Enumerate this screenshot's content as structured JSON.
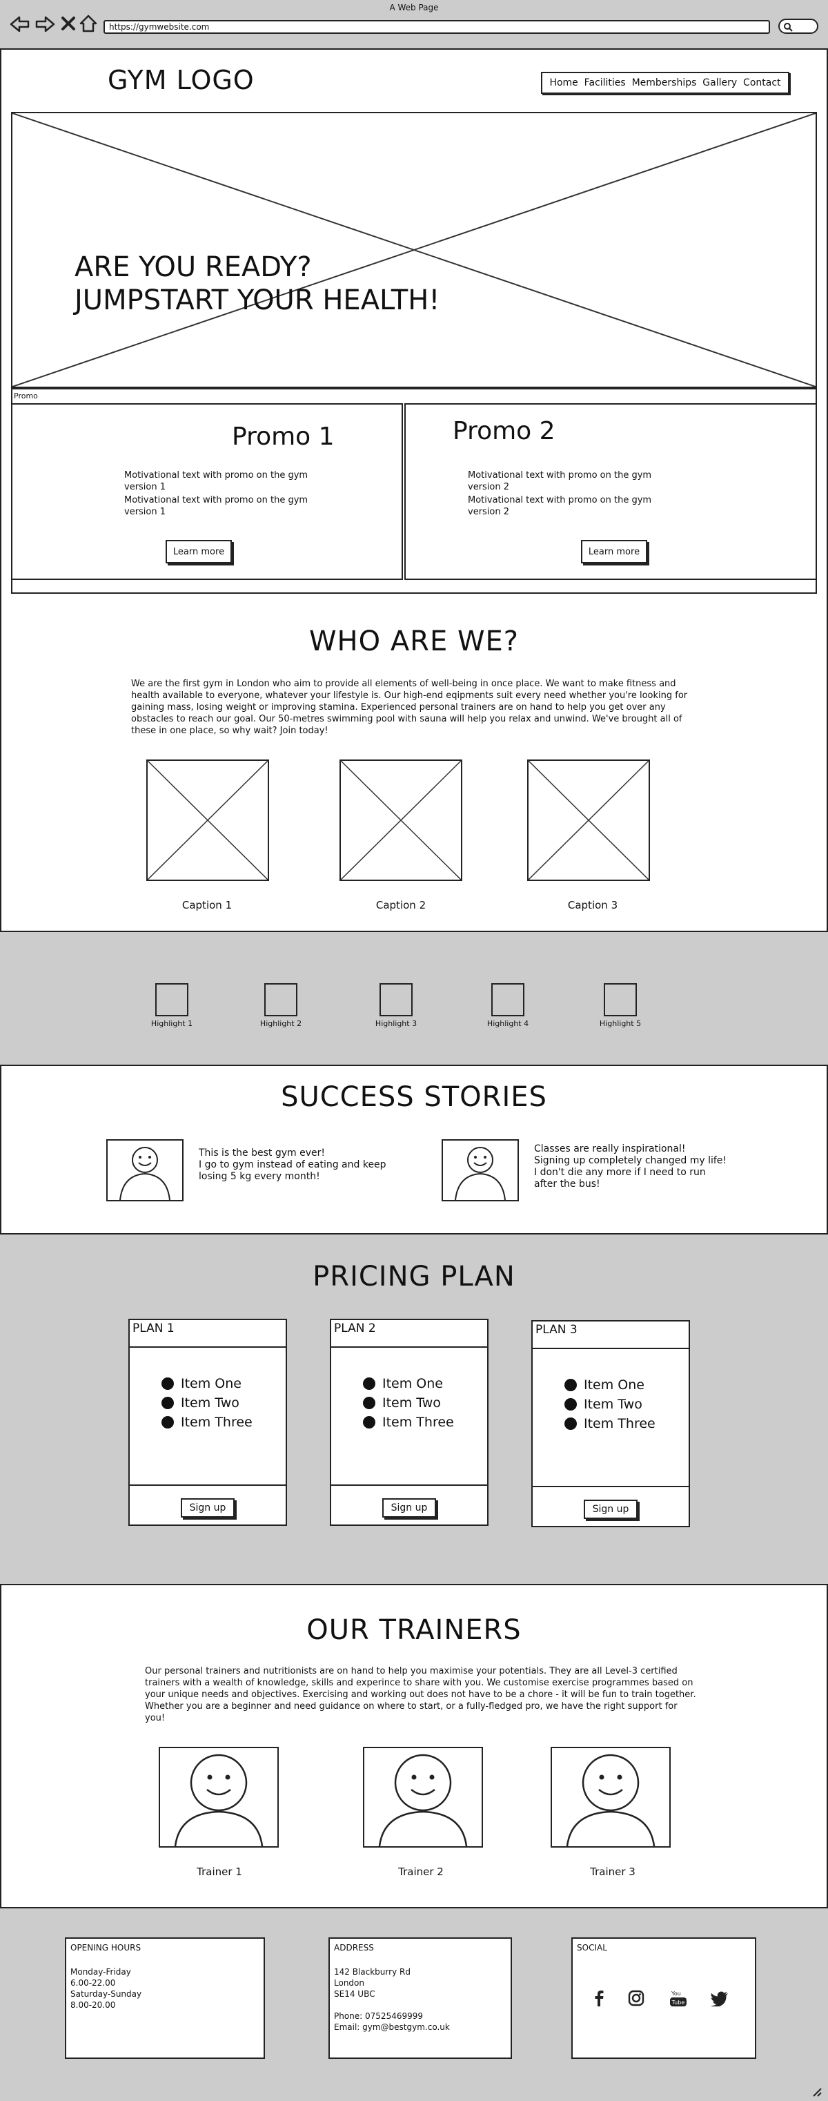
{
  "browser": {
    "window_title": "A Web Page",
    "url": "https://gymwebsite.com",
    "icons": [
      "back-icon",
      "forward-icon",
      "close-icon",
      "home-icon",
      "search-icon"
    ]
  },
  "header": {
    "logo": "GYM LOGO",
    "nav": [
      "Home",
      "Facilities",
      "Memberships",
      "Gallery",
      "Contact"
    ]
  },
  "hero": {
    "line1": "ARE YOU READY?",
    "line2": "JUMPSTART YOUR HEALTH!"
  },
  "promo": {
    "label": "Promo",
    "cards": [
      {
        "title": "Promo 1",
        "text1": "Motivational text with promo on the gym version 1",
        "text2": "Motivational text with promo on the gym version 1",
        "button": "Learn more"
      },
      {
        "title": "Promo 2",
        "text1": "Motivational text with promo on the gym version 2",
        "text2": "Motivational text with promo on the gym version 2",
        "button": "Learn more"
      }
    ]
  },
  "who": {
    "title": "WHO ARE WE?",
    "text": "We are the first gym in London who aim to provide all elements of well-being in once place. We want to make fitness and health available to everyone, whatever your lifestyle is. Our high-end eqipments suit every need whether you're looking for gaining mass, losing weight or improving stamina. Experienced personal trainers are on hand to help you get over any obstacles to reach our goal. Our 50-metres swimming pool with sauna will help you relax and unwind. We've brought all of these in one place, so why wait? Join today!",
    "captions": [
      "Caption 1",
      "Caption 2",
      "Caption 3"
    ]
  },
  "highlights": [
    "Highlight 1",
    "Highlight 2",
    "Highlight 3",
    "Highlight 4",
    "Highlight 5"
  ],
  "stories": {
    "title": "SUCCESS STORIES",
    "items": [
      {
        "text": "This is the best gym ever!\nI go to gym instead of eating and keep losing 5 kg every month!"
      },
      {
        "text": "Classes are really inspirational!\nSigning up completely changed my life! I don't die any more if I need to run after the bus!"
      }
    ]
  },
  "pricing": {
    "title": "PRICING PLAN",
    "plans": [
      {
        "name": "PLAN 1",
        "items": [
          "Item One",
          "Item Two",
          "Item Three"
        ],
        "button": "Sign up"
      },
      {
        "name": "PLAN 2",
        "items": [
          "Item One",
          "Item Two",
          "Item Three"
        ],
        "button": "Sign up"
      },
      {
        "name": "PLAN 3",
        "items": [
          "Item One",
          "Item Two",
          "Item Three"
        ],
        "button": "Sign up"
      }
    ]
  },
  "trainers": {
    "title": "OUR TRAINERS",
    "text": "Our personal trainers and nutritionists are on hand to help you maximise your potentials. They are all Level-3 certified trainers with a wealth of knowledge, skills and experince to share with you. We customise exercise programmes based on your unique needs and objectives. Exercising and working out does not have to be a chore - it will be fun to train together. Whether you are a beginner and need guidance on where to start, or a fully-fledged pro, we have the right support for you!",
    "names": [
      "Trainer 1",
      "Trainer 2",
      "Trainer 3"
    ]
  },
  "footer": {
    "hours": {
      "title": "OPENING HOURS",
      "lines": [
        "Monday-Friday",
        "6.00-22.00",
        "Saturday-Sunday",
        "8.00-20.00"
      ]
    },
    "address": {
      "title": "ADDRESS",
      "lines": [
        "142 Blackburry Rd",
        "London",
        "SE14 UBC"
      ],
      "phone": "Phone: 07525469999",
      "email": "Email: gym@bestgym.co.uk"
    },
    "social": {
      "title": "SOCIAL",
      "icons": [
        "facebook-icon",
        "instagram-icon",
        "youtube-icon",
        "twitter-icon"
      ]
    }
  }
}
